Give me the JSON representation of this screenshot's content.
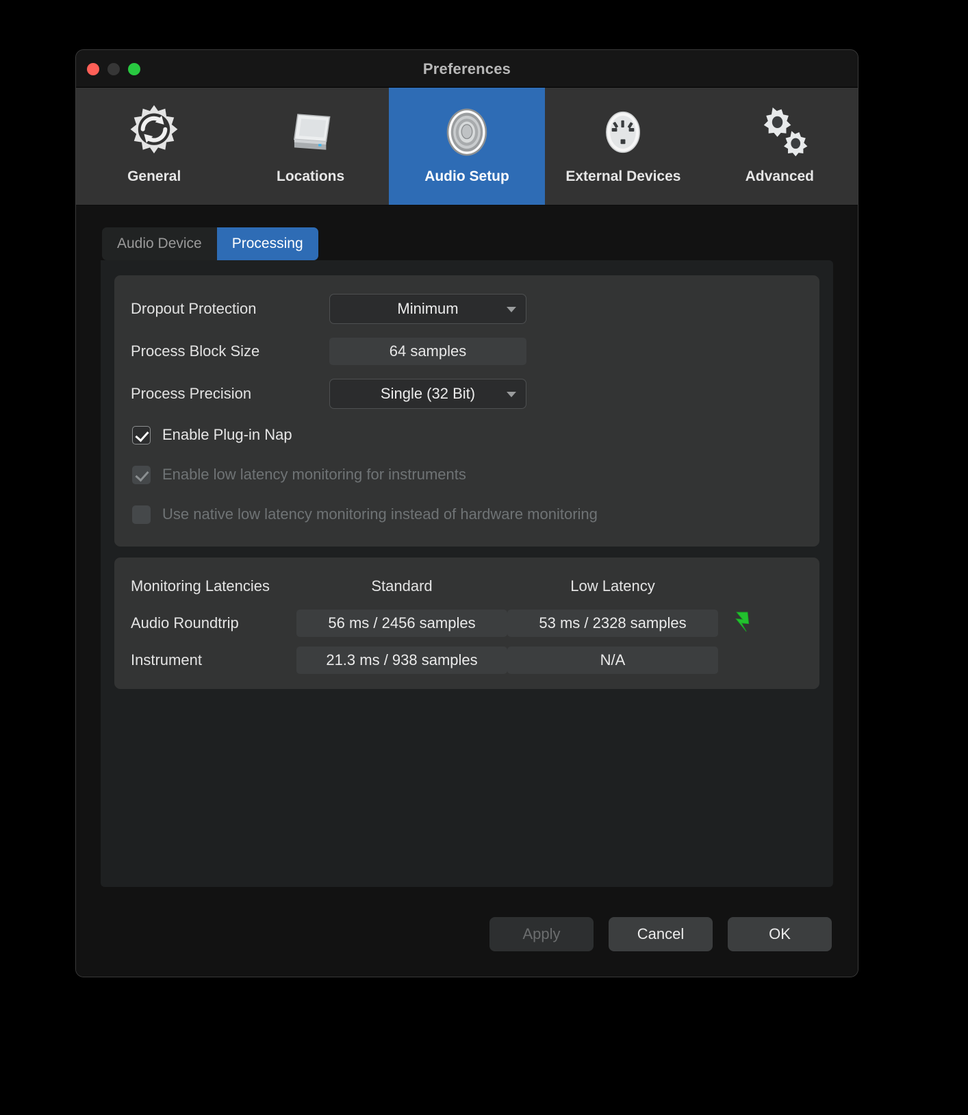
{
  "window": {
    "title": "Preferences",
    "traffic_lights": [
      {
        "name": "close",
        "color": "#ff5f57"
      },
      {
        "name": "minimize",
        "color": "#363636"
      },
      {
        "name": "zoom",
        "color": "#28c840"
      }
    ]
  },
  "toolbar": {
    "selected": "Audio Setup",
    "items": [
      {
        "label": "General",
        "icon": "gear-refresh-icon",
        "selected": false
      },
      {
        "label": "Locations",
        "icon": "hard-drive-icon",
        "selected": false
      },
      {
        "label": "Audio Setup",
        "icon": "speaker-icon",
        "selected": true
      },
      {
        "label": "External Devices",
        "icon": "midi-port-icon",
        "selected": false
      },
      {
        "label": "Advanced",
        "icon": "two-gears-icon",
        "selected": false
      }
    ]
  },
  "tabs": [
    {
      "label": "Audio Device",
      "active": false
    },
    {
      "label": "Processing",
      "active": true
    }
  ],
  "processing": {
    "dropout_protection": {
      "label": "Dropout Protection",
      "value": "Minimum",
      "type": "dropdown"
    },
    "process_block_size": {
      "label": "Process Block Size",
      "value": "64 samples",
      "type": "readonly"
    },
    "process_precision": {
      "label": "Process Precision",
      "value": "Single (32 Bit)",
      "type": "dropdown"
    },
    "checkboxes": [
      {
        "label": "Enable Plug-in Nap",
        "checked": true,
        "enabled": true
      },
      {
        "label": "Enable low latency monitoring for instruments",
        "checked": true,
        "enabled": false
      },
      {
        "label": "Use native low latency monitoring instead of hardware monitoring",
        "checked": false,
        "enabled": false
      }
    ]
  },
  "latencies": {
    "title": "Monitoring Latencies",
    "columns": [
      "Standard",
      "Low Latency"
    ],
    "rows": [
      {
        "name": "Audio Roundtrip",
        "standard": "56 ms / 2456 samples",
        "low_latency": "53 ms / 2328 samples",
        "badge": "lightning-bolt-icon"
      },
      {
        "name": "Instrument",
        "standard": "21.3 ms / 938 samples",
        "low_latency": "N/A",
        "badge": ""
      }
    ]
  },
  "footer": {
    "apply": {
      "label": "Apply",
      "enabled": false
    },
    "cancel": {
      "label": "Cancel",
      "enabled": true
    },
    "ok": {
      "label": "OK",
      "enabled": true
    }
  },
  "colors": {
    "accent": "#2e6cb5",
    "badge_green": "#22c12e",
    "window_bg": "#1b1b1b",
    "toolbar_bg": "#333333",
    "content_bg": "#121212",
    "panel_bg": "#1e2021",
    "group_bg": "#333434"
  }
}
